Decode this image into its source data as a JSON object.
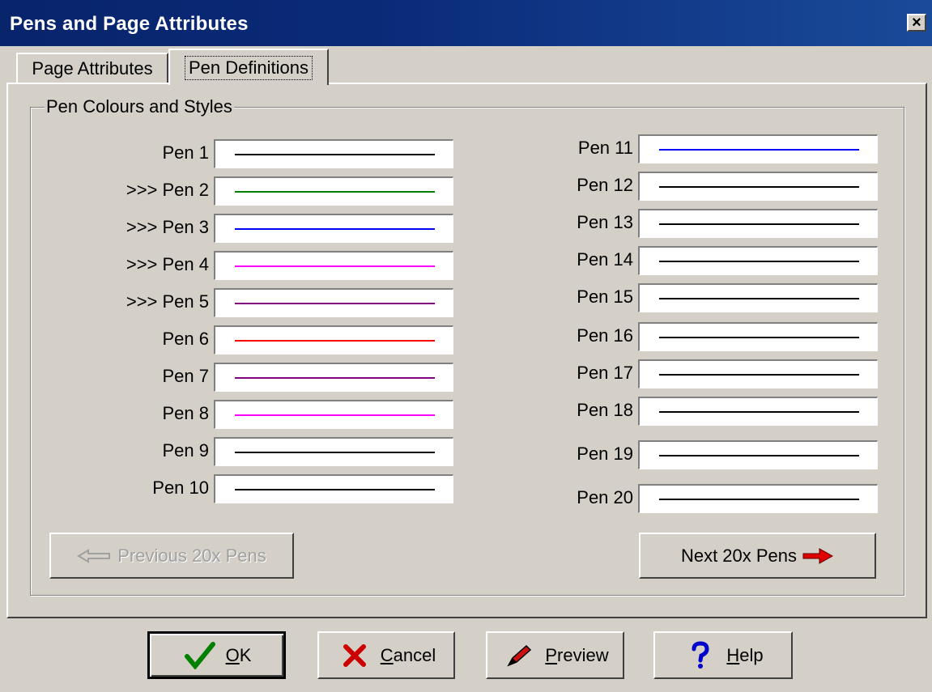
{
  "window": {
    "title": "Pens and Page Attributes",
    "close_label": "×"
  },
  "tabs": [
    {
      "label": "Page Attributes"
    },
    {
      "label": "Pen Definitions"
    }
  ],
  "group": {
    "legend": "Pen Colours and Styles"
  },
  "pens_left": [
    {
      "label": "Pen 1",
      "color": "#000000"
    },
    {
      "label": ">>> Pen 2",
      "color": "#008000"
    },
    {
      "label": ">>> Pen 3",
      "color": "#0000ff"
    },
    {
      "label": ">>> Pen 4",
      "color": "#ff00ff"
    },
    {
      "label": ">>> Pen 5",
      "color": "#800080"
    },
    {
      "label": "Pen 6",
      "color": "#ff0000"
    },
    {
      "label": "Pen 7",
      "color": "#800080"
    },
    {
      "label": "Pen 8",
      "color": "#ff00ff"
    },
    {
      "label": "Pen 9",
      "color": "#000000"
    },
    {
      "label": "Pen 10",
      "color": "#000000"
    }
  ],
  "pens_right": [
    {
      "label": "Pen 11",
      "color": "#0000ff"
    },
    {
      "label": "Pen 12",
      "color": "#000000"
    },
    {
      "label": "Pen 13",
      "color": "#000000"
    },
    {
      "label": "Pen 14",
      "color": "#000000"
    },
    {
      "label": "Pen 15",
      "color": "#000000"
    },
    {
      "label": "Pen 16",
      "color": "#000000"
    },
    {
      "label": "Pen 17",
      "color": "#000000"
    },
    {
      "label": "Pen 18",
      "color": "#000000"
    },
    {
      "label": "Pen 19",
      "color": "#000000"
    },
    {
      "label": "Pen 20",
      "color": "#000000"
    }
  ],
  "nav": {
    "prev_label": "Previous 20x Pens",
    "next_label": "Next 20x Pens",
    "prev_icon": "left-arrow-icon",
    "next_icon": "right-arrow-icon"
  },
  "buttons": {
    "ok": {
      "pre": "",
      "u": "O",
      "post": "K",
      "icon": "checkmark-icon"
    },
    "cancel": {
      "pre": "",
      "u": "C",
      "post": "ancel",
      "icon": "x-icon"
    },
    "preview": {
      "pre": "",
      "u": "P",
      "post": "review",
      "icon": "pencil-icon"
    },
    "help": {
      "pre": "",
      "u": "H",
      "post": "elp",
      "icon": "question-icon"
    }
  }
}
